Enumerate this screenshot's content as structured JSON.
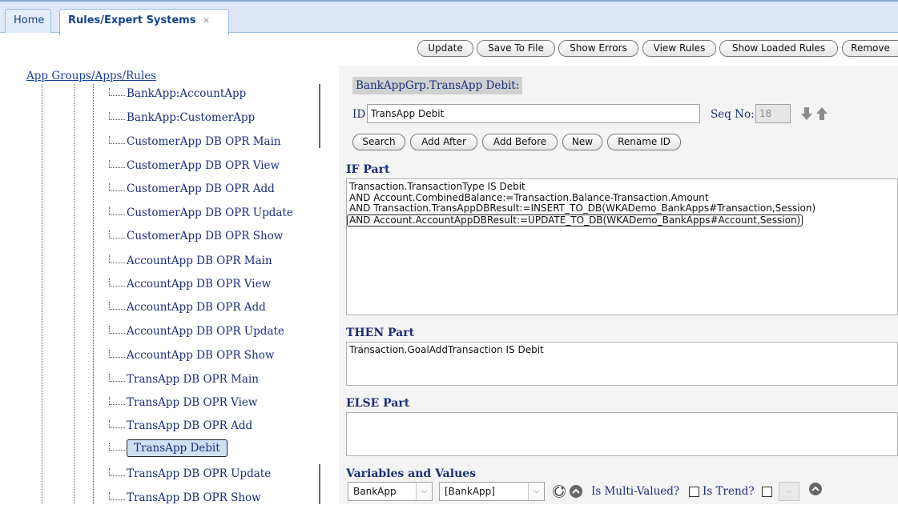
{
  "tabs": {
    "home": "Home",
    "active": "Rules/Expert Systems",
    "close_glyph": "×"
  },
  "toolbar": {
    "update": "Update",
    "save_to_file": "Save To File",
    "show_errors": "Show Errors",
    "view_rules": "View Rules",
    "show_loaded_rules": "Show Loaded Rules",
    "remove": "Remove"
  },
  "tree": {
    "title": "App Groups/Apps/Rules",
    "items": [
      "BankApp:AccountApp",
      "BankApp:CustomerApp",
      "CustomerApp DB OPR Main",
      "CustomerApp DB OPR View",
      "CustomerApp DB OPR Add",
      "CustomerApp DB OPR Update",
      "CustomerApp DB OPR Show",
      "AccountApp DB OPR Main",
      "AccountApp DB OPR View",
      "AccountApp DB OPR Add",
      "AccountApp DB OPR Update",
      "AccountApp DB OPR Show",
      "TransApp DB OPR Main",
      "TransApp DB OPR View",
      "TransApp DB OPR Add",
      "TransApp Debit",
      "TransApp DB OPR Update",
      "TransApp DB OPR Show"
    ],
    "selected": "TransApp Debit"
  },
  "rule": {
    "path": "BankAppGrp.TransApp Debit:",
    "id_label": "ID",
    "id_value": "TransApp Debit",
    "seq_label": "Seq No:",
    "seq_value": "18",
    "buttons": {
      "search": "Search",
      "add_after": "Add After",
      "add_before": "Add Before",
      "new": "New",
      "rename_id": "Rename ID"
    }
  },
  "if_part": {
    "title": "IF Part",
    "lines": [
      "Transaction.TransactionType IS Debit",
      "AND Account.CombinedBalance:=Transaction.Balance-Transaction.Amount",
      "AND Transaction.TransAppDBResult:=INSERT_TO_DB(WKADemo_BankApps#Transaction,Session)",
      "AND Account.AccountAppDBResult:=UPDATE_TO_DB(WKADemo_BankApps#Account,Session)"
    ]
  },
  "then_part": {
    "title": "THEN Part",
    "lines": [
      "Transaction.GoalAddTransaction IS Debit"
    ]
  },
  "else_part": {
    "title": "ELSE Part",
    "lines": []
  },
  "variables": {
    "title": "Variables and Values",
    "app_select": "BankApp",
    "value_select": "[BankApp]",
    "multi_valued_label": "Is Multi-Valued?",
    "trend_label": "Is Trend?"
  },
  "icons": {
    "arrow_down": "arrow-down-icon",
    "arrow_up": "arrow-up-icon",
    "refresh": "refresh-icon",
    "up_circle": "up-circle-icon"
  }
}
